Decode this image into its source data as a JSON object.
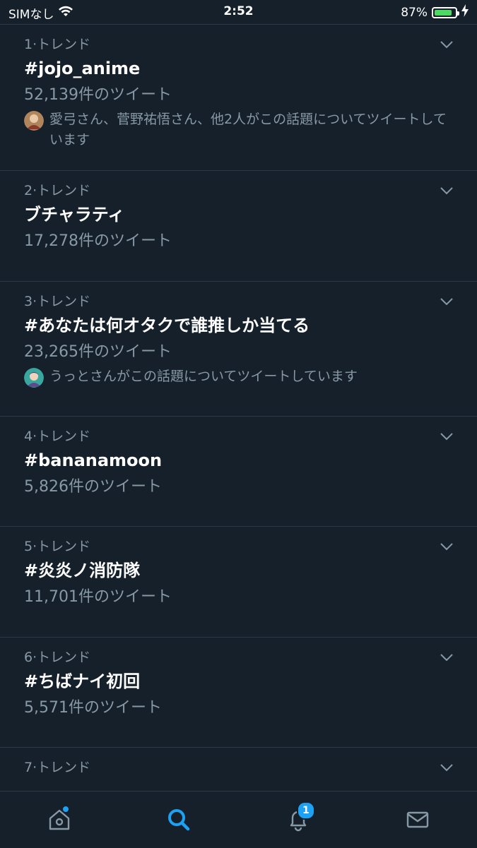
{
  "status_bar": {
    "carrier": "SIMなし",
    "time": "2:52",
    "battery_percent": "87%",
    "battery_level": 0.87
  },
  "trends": [
    {
      "rank": "1·トレンド",
      "title": "#jojo_anime",
      "count": "52,139件のツイート",
      "context": "愛弓さん、菅野祐悟さん、他2人がこの話題についてツイートしています",
      "avatar_color": "#b0855c"
    },
    {
      "rank": "2·トレンド",
      "title": "ブチャラティ",
      "count": "17,278件のツイート"
    },
    {
      "rank": "3·トレンド",
      "title": "#あなたは何オタクで誰推しか当てる",
      "count": "23,265件のツイート",
      "context": "うっとさんがこの話題についてツイートしています",
      "avatar_color": "#3aa6a0"
    },
    {
      "rank": "4·トレンド",
      "title": "#bananamoon",
      "count": "5,826件のツイート"
    },
    {
      "rank": "5·トレンド",
      "title": "#炎炎ノ消防隊",
      "count": "11,701件のツイート"
    },
    {
      "rank": "6·トレンド",
      "title": "#ちばナイ初回",
      "count": "5,571件のツイート"
    },
    {
      "rank": "7·トレンド",
      "title": "",
      "count": ""
    }
  ],
  "tab_bar": {
    "notifications_badge": "1",
    "active_tab": "search",
    "accent_color": "#1da1f2"
  }
}
